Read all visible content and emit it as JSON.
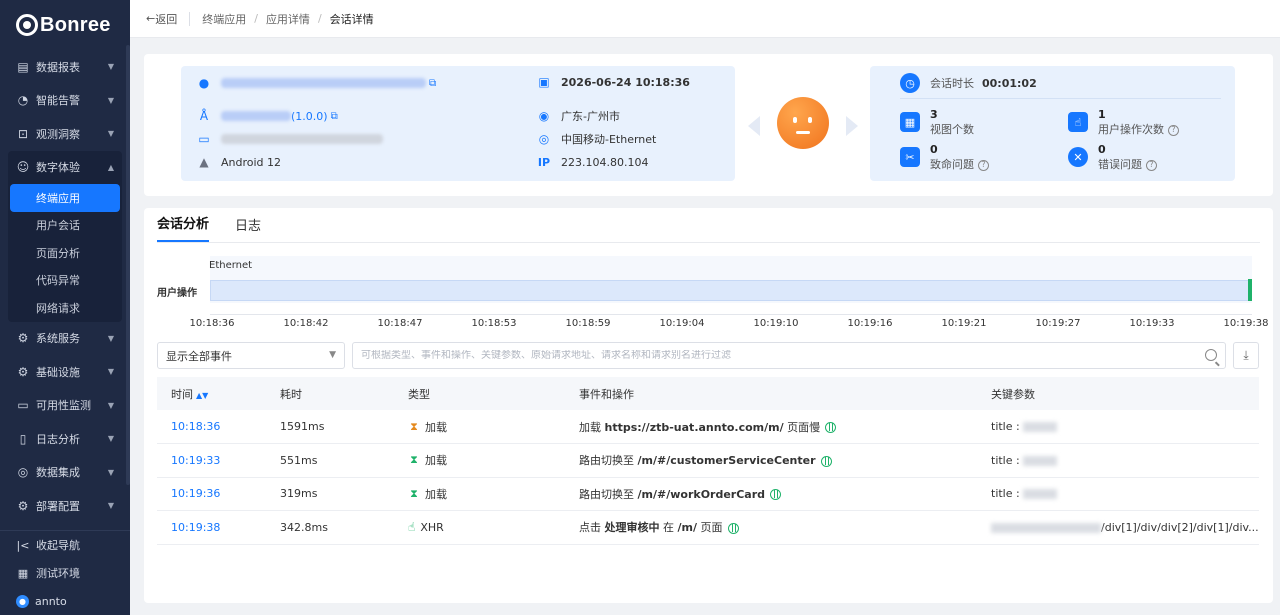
{
  "sidebar": {
    "logo": "Bonree",
    "items": [
      {
        "label": "数据报表",
        "icon": "chart-icon"
      },
      {
        "label": "智能告警",
        "icon": "alarm-icon"
      },
      {
        "label": "观测洞察",
        "icon": "insight-icon"
      }
    ],
    "group": {
      "label": "数字体验",
      "icon": "experience-icon",
      "children": [
        "终端应用",
        "用户会话",
        "页面分析",
        "代码异常",
        "网络请求"
      ],
      "active_child": "终端应用"
    },
    "items_after": [
      {
        "label": "系统服务",
        "icon": "service-icon"
      },
      {
        "label": "基础设施",
        "icon": "infra-icon"
      },
      {
        "label": "可用性监测",
        "icon": "monitor-icon"
      },
      {
        "label": "日志分析",
        "icon": "log-icon"
      },
      {
        "label": "数据集成",
        "icon": "integration-icon"
      },
      {
        "label": "部署配置",
        "icon": "deploy-icon"
      }
    ],
    "bottom": {
      "collapse": "收起导航",
      "env": "测试环境",
      "user": "annto"
    }
  },
  "topbar": {
    "back": "返回",
    "breadcrumb": [
      "终端应用",
      "应用详情",
      "会话详情"
    ]
  },
  "session": {
    "version": "(1.0.0)",
    "os": "Android 12",
    "start_time": "2026-06-24 10:18:36",
    "location": "广东-广州市",
    "network": "中国移动-Ethernet",
    "ip": "223.104.80.104",
    "duration_label": "会话时长",
    "duration": "00:01:02",
    "stats": [
      {
        "value": "3",
        "label": "视图个数"
      },
      {
        "value": "1",
        "label": "用户操作次数"
      },
      {
        "value": "0",
        "label": "致命问题"
      },
      {
        "value": "0",
        "label": "错误问题"
      }
    ]
  },
  "tabs": [
    "会话分析",
    "日志"
  ],
  "timeline": {
    "network_label": "Ethernet",
    "row_label": "用户操作",
    "ticks": [
      "10:18:36",
      "10:18:42",
      "10:18:47",
      "10:18:53",
      "10:18:59",
      "10:19:04",
      "10:19:10",
      "10:19:16",
      "10:19:21",
      "10:19:27",
      "10:19:33",
      "10:19:38"
    ]
  },
  "filter": {
    "select_value": "显示全部事件",
    "search_placeholder": "可根据类型、事件和操作、关键参数、原始请求地址、请求名称和请求别名进行过滤"
  },
  "table": {
    "headers": [
      "时间",
      "耗时",
      "类型",
      "事件和操作",
      "关键参数"
    ],
    "rows": [
      {
        "time": "10:18:36",
        "cost": "1591ms",
        "type": "加载",
        "type_icon": "hourglass-orange",
        "action_pre": "加载 ",
        "action_bold": "https://ztb-uat.annto.com/m/",
        "action_post": " 页面慢",
        "param": "title :"
      },
      {
        "time": "10:19:33",
        "cost": "551ms",
        "type": "加载",
        "type_icon": "hourglass-green",
        "action_pre": "路由切换至 ",
        "action_bold": "/m/#/customerServiceCenter",
        "action_post": "",
        "param": "title :"
      },
      {
        "time": "10:19:36",
        "cost": "319ms",
        "type": "加载",
        "type_icon": "hourglass-green",
        "action_pre": "路由切换至 ",
        "action_bold": "/m/#/workOrderCard",
        "action_post": "",
        "param": "title :"
      },
      {
        "time": "10:19:38",
        "cost": "342.8ms",
        "type": "XHR",
        "type_icon": "hand-pointer",
        "action_pre": "点击 ",
        "action_bold": "处理审核中",
        "action_mid": " 在 ",
        "action_bold2": "/m/",
        "action_post": " 页面",
        "param": "/div[1]/div/div[2]/div[1]/div..."
      }
    ]
  },
  "colors": {
    "primary": "#1677ff",
    "sidebar_bg": "#1f2a44",
    "panel_bg": "#e8f1fd",
    "face": "#f0731d",
    "success": "#1fb26a",
    "warning": "#e58a1f"
  }
}
